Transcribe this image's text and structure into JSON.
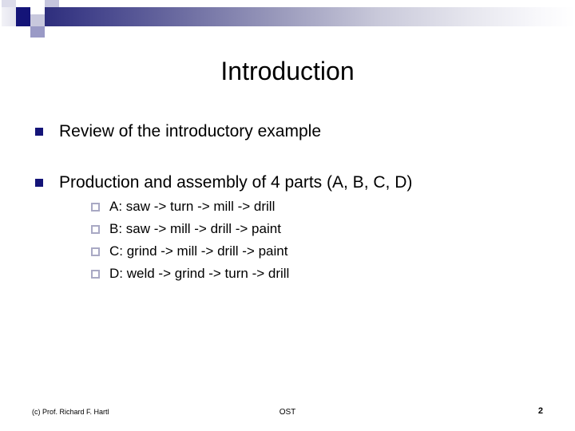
{
  "slide": {
    "title": "Introduction",
    "accent_color": "#141478",
    "banner_gradient_from": "#2e2e7d",
    "banner_gradient_to": "#ffffff",
    "background_color": "#ffffff",
    "bullets": [
      {
        "text": "Review of the introductory example",
        "bullet_icon": "filled-square-bullet-icon",
        "subitems": []
      },
      {
        "text": "Production and assembly of 4 parts (A, B, C, D)",
        "bullet_icon": "filled-square-bullet-icon",
        "subitems": [
          {
            "text": "A: saw -> turn -> mill -> drill",
            "bullet_icon": "hollow-square-bullet-icon"
          },
          {
            "text": "B: saw -> mill -> drill -> paint",
            "bullet_icon": "hollow-square-bullet-icon"
          },
          {
            "text": "C: grind -> mill -> drill -> paint",
            "bullet_icon": "hollow-square-bullet-icon"
          },
          {
            "text": "D: weld -> grind -> turn -> drill",
            "bullet_icon": "hollow-square-bullet-icon"
          }
        ]
      }
    ],
    "footer": {
      "left": "(c) Prof. Richard F. Hartl",
      "center": "OST",
      "page_number": "2"
    }
  }
}
